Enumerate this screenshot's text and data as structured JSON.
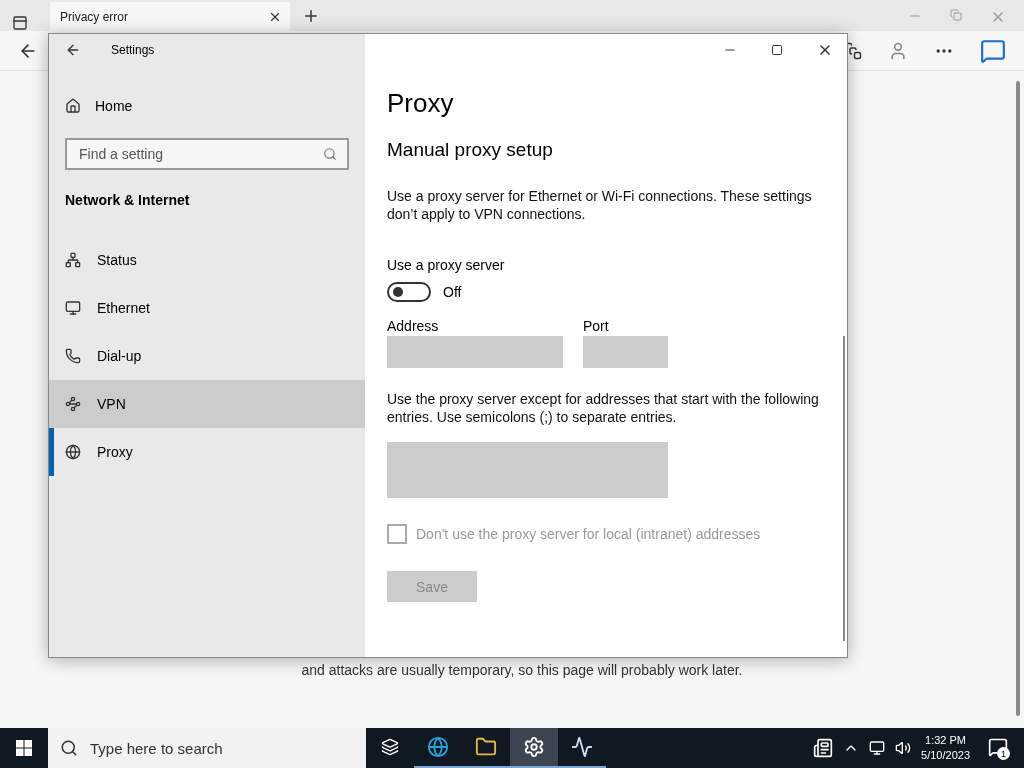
{
  "browser": {
    "tab": {
      "title": "Privacy error"
    },
    "page_text": "and attacks are usually temporary, so this page will probably work later."
  },
  "settings": {
    "title": "Settings",
    "home": "Home",
    "search": {
      "placeholder": "Find a setting"
    },
    "section": "Network & Internet",
    "items": [
      {
        "label": "Status",
        "selected": false,
        "hovered": false
      },
      {
        "label": "Ethernet",
        "selected": false,
        "hovered": false
      },
      {
        "label": "Dial-up",
        "selected": false,
        "hovered": false
      },
      {
        "label": "VPN",
        "selected": false,
        "hovered": true
      },
      {
        "label": "Proxy",
        "selected": true,
        "hovered": false
      }
    ],
    "page": {
      "heading": "Proxy",
      "subheading": "Manual proxy setup",
      "description": "Use a proxy server for Ethernet or Wi-Fi connections. These settings don’t apply to VPN connections.",
      "toggle": {
        "label": "Use a proxy server",
        "on": false,
        "state_text": "Off"
      },
      "address_label": "Address",
      "port_label": "Port",
      "exceptions_text": "Use the proxy server except for addresses that start with the following entries. Use semicolons (;) to separate entries.",
      "local_checkbox": {
        "label": "Don't use the proxy server for local (intranet) addresses",
        "checked": false,
        "disabled": true
      },
      "save": {
        "label": "Save",
        "disabled": true
      }
    }
  },
  "taskbar": {
    "search": {
      "placeholder": "Type here to search"
    },
    "apps": [
      {
        "selected": false
      },
      {
        "selected": false
      },
      {
        "selected": true
      },
      {
        "selected": false
      }
    ],
    "time": "1:32 PM",
    "date": "5/10/2023",
    "notifications": "1"
  }
}
